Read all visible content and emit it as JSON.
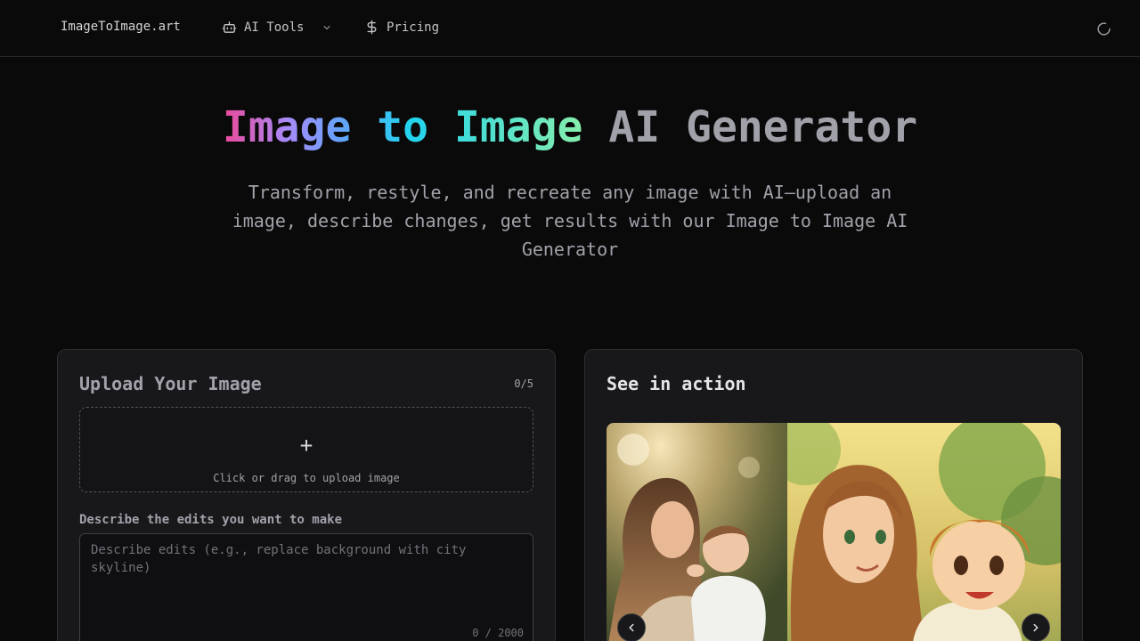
{
  "nav": {
    "brand": "ImageToImage.art",
    "tools_label": "AI Tools",
    "pricing_label": "Pricing"
  },
  "hero": {
    "title_grad": "Image to Image",
    "title_plain": "AI Generator",
    "subtitle": "Transform, restyle, and recreate any image with AI—upload an image, describe changes, get results with our Image to Image AI Generator"
  },
  "upload_card": {
    "title": "Upload Your Image",
    "counter": "0/5",
    "plus": "+",
    "drop_hint": "Click or drag to upload image",
    "field_label": "Describe the edits you want to make",
    "placeholder": "Describe edits (e.g., replace background with city skyline)",
    "char_count": "0 / 2000"
  },
  "showcase_card": {
    "title": "See in action"
  },
  "colors": {
    "background": "#0a0a0a",
    "card": "#18181b",
    "gradient_start": "#ec4899",
    "gradient_end": "#86efac"
  },
  "icons": {
    "tools": "robot-icon",
    "pricing": "dollar-icon",
    "loading": "spinner-icon",
    "prev": "chevron-left-icon",
    "next": "chevron-right-icon"
  }
}
